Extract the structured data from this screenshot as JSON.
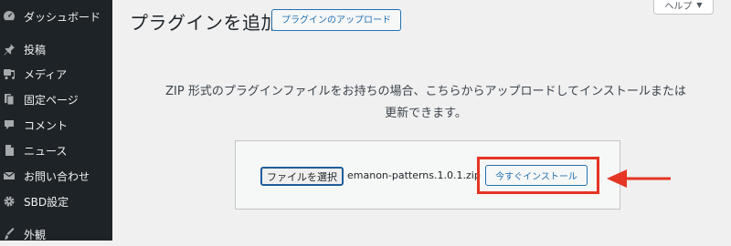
{
  "sidebar": {
    "items": [
      {
        "label": "ダッシュボード",
        "icon": "dashboard-icon"
      },
      {
        "label": "投稿",
        "icon": "pin-icon"
      },
      {
        "label": "メディア",
        "icon": "media-icon"
      },
      {
        "label": "固定ページ",
        "icon": "pages-icon"
      },
      {
        "label": "コメント",
        "icon": "comment-icon"
      },
      {
        "label": "ニュース",
        "icon": "news-icon"
      },
      {
        "label": "お問い合わせ",
        "icon": "mail-icon"
      },
      {
        "label": "SBD設定",
        "icon": "gear-icon"
      },
      {
        "label": "外観",
        "icon": "brush-icon"
      }
    ]
  },
  "header": {
    "title": "プラグインを追加",
    "upload_button": "プラグインのアップロード",
    "help_button": "ヘルプ"
  },
  "upload": {
    "description_line1": "ZIP 形式のプラグインファイルをお持ちの場合、こちらからアップロードしてインストールまたは",
    "description_line2": "更新できます。",
    "choose_file_label": "ファイルを選択",
    "file_name": "emanon-patterns.1.0.1.zip",
    "install_label": "今すぐインストール"
  },
  "colors": {
    "sidebar_bg": "#1d2327",
    "accent": "#2271b1",
    "annotation": "#e53524",
    "page_bg": "#f0f0f1"
  }
}
